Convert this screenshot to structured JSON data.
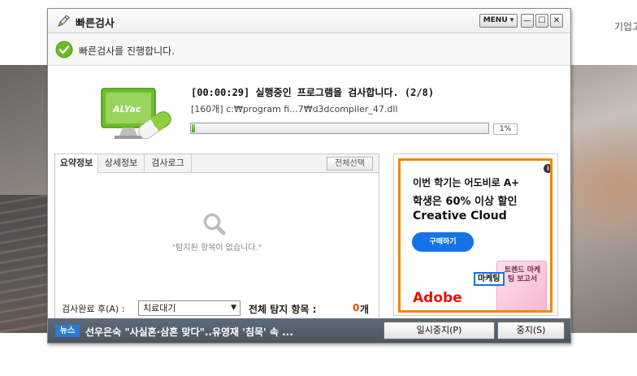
{
  "background": {
    "corner_text": "기업고"
  },
  "window": {
    "title": "빠른검사",
    "menu_label": "MENU ▾",
    "minimize_label": "—",
    "maximize_label": "☐",
    "close_label": "✕"
  },
  "status": {
    "text": "빠른검사를 진행합니다."
  },
  "scan": {
    "logo_text": "ALYac",
    "time_line": "[00:00:29] 실행중인 프로그램을 검사합니다. (2/8)",
    "file_line": "[160개] c:₩program fi...7₩d3dcompiler_47.dll",
    "progress_percent": 1,
    "progress_label": "1%"
  },
  "tabs": [
    {
      "label": "요약정보",
      "active": true
    },
    {
      "label": "상세정보",
      "active": false
    },
    {
      "label": "검사로그",
      "active": false
    }
  ],
  "panel": {
    "select_all_label": "전체선택",
    "empty_text": "\"탐지된 항목이 없습니다.\"",
    "after_scan_label": "검사완료 후(A) :",
    "after_scan_value": "치료대기",
    "total_label": "전체 탐지 항목 :",
    "total_count": "0",
    "total_unit": "개"
  },
  "ad": {
    "line1": "이번 학기는 어도비로 A+",
    "line2": "학생은 60% 이상 할인",
    "line3": "Creative Cloud",
    "button": "구매하기",
    "tag": "마케팅",
    "book_text": "트렌드 마케팅 보고서",
    "brand": "Adobe",
    "info": "i"
  },
  "bottom": {
    "news_badge": "뉴스",
    "news_text": "선우은숙 \"사실혼·삼혼 맞다\"..유영재 '침묵' 속 ...",
    "pause_label": "일시중지(P)",
    "stop_label": "중지(S)"
  },
  "colors": {
    "accent_green": "#4ea52f",
    "count_orange": "#e64b00",
    "ad_border": "#f0870e",
    "adobe_red": "#eb1000",
    "news_blue": "#2d7bd6"
  },
  "icons": {
    "title": "pencil-icon",
    "status": "check-circle-icon",
    "empty": "magnifier-icon",
    "logo": "alyac-monitor-logo"
  }
}
